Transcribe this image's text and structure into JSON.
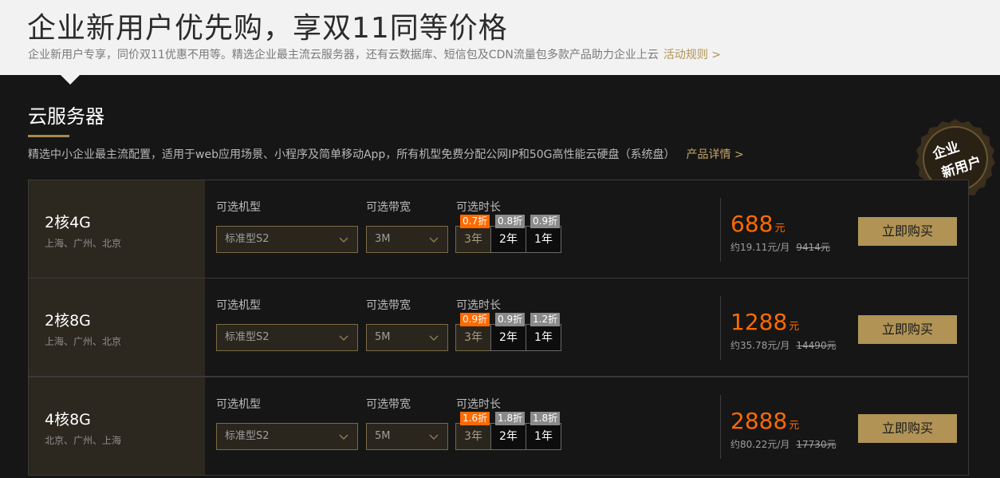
{
  "banner": {
    "title": "企业新用户优先购，享双11同等价格",
    "subtitle": "企业新用户专享，同价双11优惠不用等。精选企业最主流云服务器，还有云数据库、短信包及CDN流量包多款产品助力企业上云",
    "rules_link": "活动规则 >"
  },
  "section": {
    "title": "云服务器",
    "description": "精选中小企业最主流配置，适用于web应用场景、小程序及简单移动App，所有机型免费分配公网IP和50G高性能云硬盘（系统盘）",
    "detail_link": "产品详情 >"
  },
  "seal": {
    "line1": "企业",
    "line2": "新用户"
  },
  "labels": {
    "type": "可选机型",
    "bandwidth": "可选带宽",
    "duration": "可选时长",
    "buy": "立即购买"
  },
  "durations": [
    "3年",
    "2年",
    "1年"
  ],
  "products": [
    {
      "spec": "2核4G",
      "regions": "上海、广州、北京",
      "type": "标准型S2",
      "bandwidth": "3M",
      "discounts": [
        "0.7折",
        "0.8折",
        "0.9折"
      ],
      "price": "688",
      "unit": "元",
      "monthly": "约19.11元/月",
      "original": "9414元"
    },
    {
      "spec": "2核8G",
      "regions": "上海、广州、北京",
      "type": "标准型S2",
      "bandwidth": "5M",
      "discounts": [
        "0.9折",
        "0.9折",
        "1.2折"
      ],
      "price": "1288",
      "unit": "元",
      "monthly": "约35.78元/月",
      "original": "14490元"
    },
    {
      "spec": "4核8G",
      "regions": "北京、广州、上海",
      "type": "标准型S2",
      "bandwidth": "5M",
      "discounts": [
        "1.6折",
        "1.8折",
        "1.8折"
      ],
      "price": "2888",
      "unit": "元",
      "monthly": "约80.22元/月",
      "original": "17730元"
    }
  ],
  "colors": {
    "accent": "#b09355",
    "price": "#ff6a00",
    "background": "#161616"
  }
}
